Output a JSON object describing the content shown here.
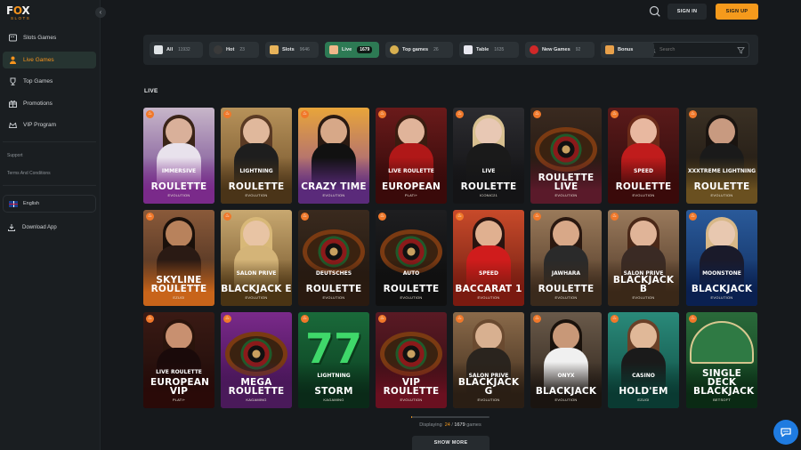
{
  "brand": {
    "name_prefix": "F",
    "name_o": "O",
    "name_suffix": "X",
    "tagline": "SLOTS",
    "accent": "#f7941d"
  },
  "sidebar": {
    "items": [
      {
        "label": "Slots Games",
        "icon": "slot-machine-icon",
        "active": false
      },
      {
        "label": "Live Games",
        "icon": "dealer-icon",
        "active": true
      },
      {
        "label": "Top Games",
        "icon": "trophy-icon",
        "active": false
      },
      {
        "label": "Promotions",
        "icon": "gift-icon",
        "active": false
      },
      {
        "label": "VIP Program",
        "icon": "crown-icon",
        "active": false
      }
    ],
    "support": "Support",
    "terms": "Terms And Conditions",
    "language": "English",
    "download": "Download App"
  },
  "header": {
    "signin": "SIGN IN",
    "signup": "SIGN UP"
  },
  "filters": [
    {
      "label": "All",
      "count": "11932",
      "icon": "all-icon",
      "active": false
    },
    {
      "label": "Hot",
      "count": "23",
      "icon": "bomb-icon",
      "active": false
    },
    {
      "label": "Slots",
      "count": "9646",
      "icon": "slots-icon",
      "active": false
    },
    {
      "label": "Live",
      "count": "1679",
      "icon": "live-dealer-icon",
      "active": true
    },
    {
      "label": "Top games",
      "count": "26",
      "icon": "coin-icon",
      "active": false
    },
    {
      "label": "Table",
      "count": "1635",
      "icon": "cards-icon",
      "active": false
    },
    {
      "label": "New Games",
      "count": "92",
      "icon": "cherry-icon",
      "active": false
    },
    {
      "label": "Bonus",
      "count": "",
      "icon": "bonus-icon",
      "active": false
    }
  ],
  "search": {
    "placeholder": "Search"
  },
  "section": {
    "title": "LIVE"
  },
  "games": [
    {
      "line1": "IMMERSIVE",
      "line2": "ROULETTE",
      "provider": "EVOLUTION",
      "bg": "#c7b6c9",
      "bg2": "#6a3a8a",
      "shade": "#7a2a8a",
      "kind": "person",
      "skin": "#d9b09a",
      "hair": "#3a2418",
      "body": "#e8e2ec"
    },
    {
      "line1": "LIGHTNING",
      "line2": "ROULETTE",
      "provider": "EVOLUTION",
      "bg": "#b7925a",
      "bg2": "#6b4c26",
      "shade": "#4a3418",
      "kind": "person",
      "skin": "#e0b89c",
      "hair": "#5a3a24",
      "body": "#1e1e1e"
    },
    {
      "line1": "",
      "line2": "CRAZY TIME",
      "provider": "EVOLUTION",
      "bg": "#e8a53a",
      "bg2": "#8a4a9a",
      "shade": "#5a2a7a",
      "kind": "person",
      "skin": "#d7a888",
      "hair": "#2a1a12",
      "body": "#111111"
    },
    {
      "line1": "LIVE ROULETTE",
      "line2": "EUROPEAN",
      "provider": "PLATI+",
      "bg": "#6a1a1a",
      "bg2": "#2a0808",
      "shade": "#3a0a0a",
      "kind": "person",
      "skin": "#e0b49a",
      "hair": "#3a1c10",
      "body": "#b01818"
    },
    {
      "line1": "LIVE",
      "line2": "ROULETTE",
      "provider": "ICONIC21",
      "bg": "#2c2c30",
      "bg2": "#0e0e10",
      "shade": "#141416",
      "kind": "person",
      "skin": "#e8c8b4",
      "hair": "#d8c090",
      "body": "#1a1a1a"
    },
    {
      "line1": "",
      "line2": "ROULETTE LIVE",
      "provider": "EVOLUTION",
      "bg": "#3a2a20",
      "bg2": "#1a100a",
      "shade": "#5a1a2a",
      "kind": "wheel"
    },
    {
      "line1": "SPEED",
      "line2": "ROULETTE",
      "provider": "EVOLUTION",
      "bg": "#5a1a1a",
      "bg2": "#2a0a0a",
      "shade": "#3a0a0a",
      "kind": "person",
      "skin": "#e8b8a0",
      "hair": "#6a2a18",
      "body": "#c01c1c"
    },
    {
      "line1": "XXXTREME LIGHTNING",
      "line2": "ROULETTE",
      "provider": "EVOLUTION",
      "bg": "#3a3024",
      "bg2": "#1a140e",
      "shade": "#6a5020",
      "kind": "person",
      "skin": "#c89a80",
      "hair": "#1a1410",
      "body": "#1a1a1a"
    },
    {
      "line1": "",
      "line2": "SKYLINE ROULETTE",
      "provider": "EZUGI",
      "bg": "#8a5a3a",
      "bg2": "#3a2418",
      "shade": "#c8641a",
      "kind": "person",
      "skin": "#b8825c",
      "hair": "#1a100a",
      "body": "#2a1a14"
    },
    {
      "line1": "SALON PRIVE",
      "line2": "BLACKJACK E",
      "provider": "EVOLUTION",
      "bg": "#c8a870",
      "bg2": "#6a4c24",
      "shade": "#4a3414",
      "kind": "person",
      "skin": "#e8c4a4",
      "hair": "#d8b878",
      "body": "#d4b478"
    },
    {
      "line1": "DEUTSCHES",
      "line2": "ROULETTE",
      "provider": "EVOLUTION",
      "bg": "#3a2a1e",
      "bg2": "#1a120c",
      "shade": "#2a1a10",
      "kind": "wheel"
    },
    {
      "line1": "AUTO",
      "line2": "ROULETTE",
      "provider": "EVOLUTION",
      "bg": "#1e1e20",
      "bg2": "#0a0a0a",
      "shade": "#101010",
      "kind": "wheel"
    },
    {
      "line1": "SPEED",
      "line2": "BACCARAT 1",
      "provider": "EVOLUTION",
      "bg": "#c84a2a",
      "bg2": "#6a1a10",
      "shade": "#7a1a10",
      "kind": "person",
      "skin": "#e0b090",
      "hair": "#2a1410",
      "body": "#d01c1c"
    },
    {
      "line1": "JAWHARA",
      "line2": "ROULETTE",
      "provider": "EVOLUTION",
      "bg": "#9a7a5a",
      "bg2": "#4a3424",
      "shade": "#3a2a1c",
      "kind": "person",
      "skin": "#d8a888",
      "hair": "#2a1810",
      "body": "#2a2a2a"
    },
    {
      "line1": "SALON PRIVE",
      "line2": "BLACKJACK B",
      "provider": "EVOLUTION",
      "bg": "#9a7a5c",
      "bg2": "#4a3424",
      "shade": "#3a2818",
      "kind": "person",
      "skin": "#e0b498",
      "hair": "#4a2818",
      "body": "#3a2a24"
    },
    {
      "line1": "MOONSTONE",
      "line2": "BLACKJACK",
      "provider": "EVOLUTION",
      "bg": "#2a5a9a",
      "bg2": "#0e2a5a",
      "shade": "#0a2050",
      "kind": "person",
      "skin": "#e8c8b0",
      "hair": "#d8b888",
      "body": "#1a1a2a"
    },
    {
      "line1": "LIVE ROULETTE",
      "line2": "EUROPEAN VIP",
      "provider": "PLATI+",
      "bg": "#3a1a14",
      "bg2": "#1a0a08",
      "shade": "#2a0a08",
      "kind": "person",
      "skin": "#c89070",
      "hair": "#2a140c",
      "body": "#1a0a0a"
    },
    {
      "line1": "",
      "line2": "MEGA ROULETTE",
      "provider": "KAGAMING",
      "bg": "#7a2a8a",
      "bg2": "#3a0e4a",
      "shade": "#4a1a5a",
      "kind": "wheel"
    },
    {
      "line1": "LIGHTNING",
      "line2": "STORM",
      "provider": "KAGAMING",
      "bg": "#1a6a3a",
      "bg2": "#0a3a1e",
      "shade": "#0a2a18",
      "kind": "seven"
    },
    {
      "line1": "",
      "line2": "VIP ROULETTE",
      "provider": "EVOLUTION",
      "bg": "#5a1a24",
      "bg2": "#2a0a10",
      "shade": "#6a1020",
      "kind": "wheel"
    },
    {
      "line1": "SALON PRIVE",
      "line2": "BLACKJACK G",
      "provider": "EVOLUTION",
      "bg": "#8a6a4a",
      "bg2": "#3a2818",
      "shade": "#2a1e14",
      "kind": "person",
      "skin": "#d8b090",
      "hair": "#6a4a30",
      "body": "#2a241e"
    },
    {
      "line1": "ONYX",
      "line2": "BLACKJACK",
      "provider": "EVOLUTION",
      "bg": "#6a5a4a",
      "bg2": "#2a2018",
      "shade": "#1a1410",
      "kind": "person",
      "skin": "#c89878",
      "hair": "#1a120c",
      "body": "#f0f0f0"
    },
    {
      "line1": "CASINO",
      "line2": "HOLD'EM",
      "provider": "EZUGI",
      "bg": "#2a8a7a",
      "bg2": "#0e4a40",
      "shade": "#0a3a32",
      "kind": "person",
      "skin": "#e0b898",
      "hair": "#6a4028",
      "body": "#1a1a1a"
    },
    {
      "line1": "",
      "line2": "SINGLE DECK BLACKJACK",
      "provider": "BETSOFT",
      "bg": "#2a6a3a",
      "bg2": "#0e3a1c",
      "shade": "#0a2a14",
      "kind": "table"
    }
  ],
  "pagination": {
    "label_prefix": "Displaying",
    "shown": "24",
    "separator": "/",
    "total": "1679",
    "suffix": "games",
    "progress_fraction": 0.0143,
    "button": "SHOW MORE"
  },
  "colors": {
    "accent": "#f59a1c",
    "active_chip": "#2d7a54",
    "chat": "#1f7be0",
    "fire": "#f0782a"
  }
}
